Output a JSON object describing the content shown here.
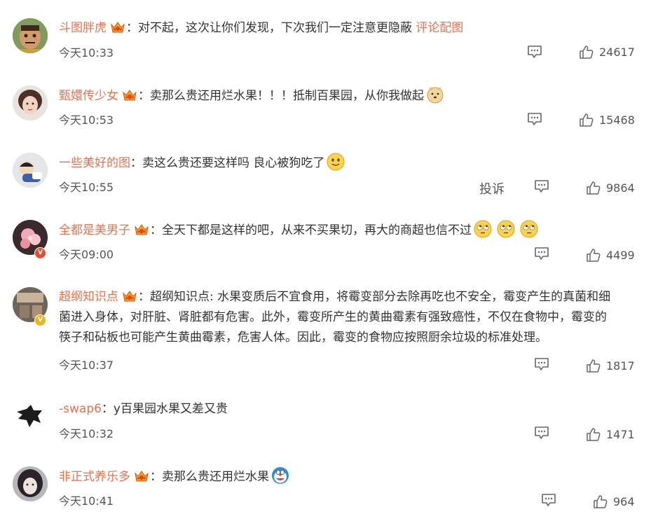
{
  "comments": [
    {
      "username": "斗图胖虎",
      "sep": "：",
      "text": "对不起，这次让你们发现，下次我们一定注意更隐蔽",
      "link": "评论配图",
      "time": "今天10:33",
      "likes": "24617",
      "avatar": "cartoon-face-avatar"
    },
    {
      "username": "甄嬛传少女",
      "sep": "：",
      "text": "卖那么贵还用烂水果！！！抵制百果园，从你我做起",
      "time": "今天10:53",
      "likes": "15468",
      "avatar": "girl-photo-avatar",
      "emoji": "doge-emoji"
    },
    {
      "username": "一些美好的图",
      "sep": "：",
      "text": "卖这么贵还要这样吗 良心被狗吃了",
      "time": "今天10:55",
      "likes": "9864",
      "report": "投诉",
      "avatar": "sleeping-cartoon-avatar",
      "emoji": "smile-emoji"
    },
    {
      "username": "全都是美男子",
      "sep": "：",
      "text": "全天下都是这样的吧，从来不买果切，再大的商超也信不过",
      "time": "今天09:00",
      "likes": "4499",
      "avatar": "pink-flower-avatar",
      "badge": "V",
      "emoji": "eye-roll-emoji"
    },
    {
      "username": "超纲知识点",
      "sep": "：",
      "line1": "超纲知识点: 水果变质后不宜食用，将霉变部分去除再吃也不安全，霉变产生的真菌和细",
      "line2": "菌进入身体，对肝脏、肾脏都有危害。此外，霉变所产生的黄曲霉素有强致癌性，不仅在食物中，霉变的",
      "line3": "筷子和砧板也可能产生黄曲霉素，危害人体。因此，霉变的食物应按照厨余垃圾的标准处理。",
      "time": "今天10:37",
      "likes": "1817",
      "avatar": "kitchen-photo-avatar",
      "badge": "V"
    },
    {
      "username": "-swap6",
      "sep": "：",
      "text": "y百果园水果又差又贵",
      "time": "今天10:32",
      "likes": "1471",
      "avatar": "wolf-logo-avatar"
    },
    {
      "username": "非正式养乐多",
      "sep": "：",
      "text": "卖那么贵还用烂水果",
      "time": "今天10:41",
      "likes": "964",
      "avatar": "dark-hair-girl-avatar",
      "emoji": "doraemon-emoji"
    }
  ],
  "colors": {
    "username": "#e8724d",
    "text": "#333333",
    "meta": "#555555",
    "icon": "#666666"
  }
}
